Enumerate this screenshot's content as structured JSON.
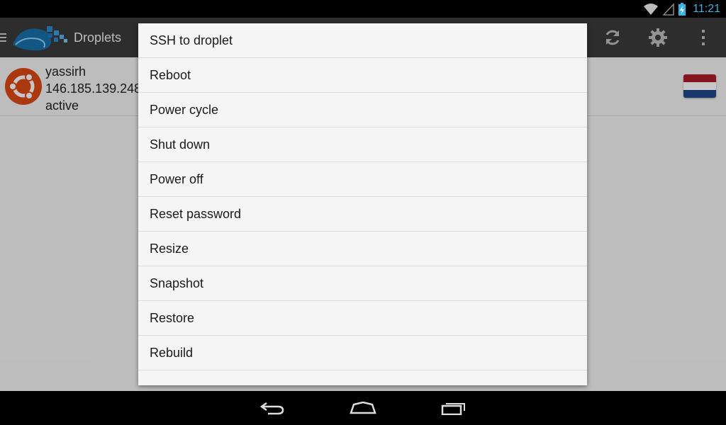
{
  "status_bar": {
    "time": "11:21",
    "icons": [
      "wifi-icon",
      "signal-icon",
      "battery-charging-icon"
    ],
    "accent_color": "#33b5e5"
  },
  "action_bar": {
    "title": "Droplets",
    "icons": [
      "drawer-menu-icon",
      "digitalocean-logo-icon",
      "refresh-icon",
      "settings-gear-icon",
      "overflow-menu-icon"
    ]
  },
  "droplet": {
    "name": "yassirh",
    "ip": "146.185.139.248",
    "status": "active",
    "os_icon": "ubuntu-icon",
    "region_flag": "netherlands-flag-icon"
  },
  "dialog": {
    "items": [
      "SSH to droplet",
      "Reboot",
      "Power cycle",
      "Shut down",
      "Power off",
      "Reset password",
      "Resize",
      "Snapshot",
      "Restore",
      "Rebuild"
    ]
  },
  "nav_bar": {
    "icons": [
      "back-icon",
      "home-icon",
      "recent-apps-icon"
    ]
  },
  "colors": {
    "action_bar": "#3a3a3a",
    "ubuntu_orange": "#dd4814",
    "flag_red": "#ae1c28",
    "flag_white": "#ffffff",
    "flag_blue": "#21468b"
  }
}
